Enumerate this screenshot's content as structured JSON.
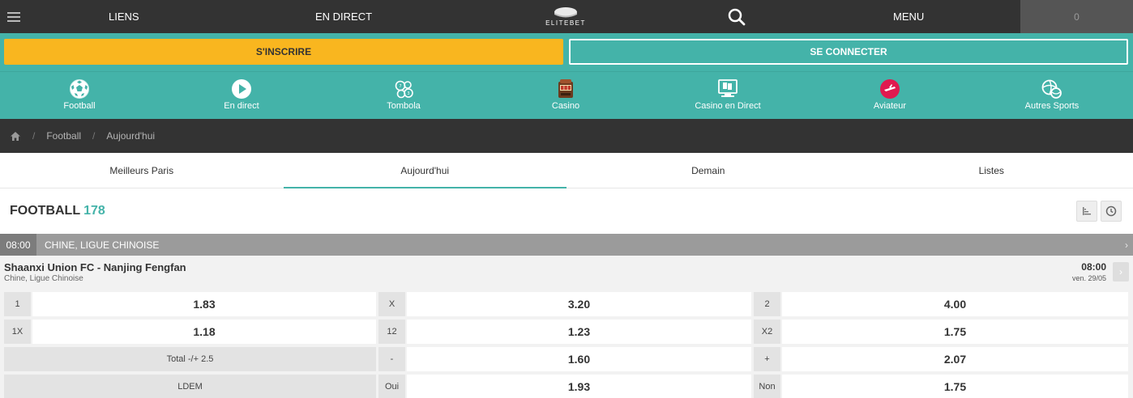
{
  "topbar": {
    "menu_icon": "hamburger-icon",
    "links": "LIENS",
    "live": "EN DIRECT",
    "logo_text": "ELITEBET",
    "search_icon": "search-icon",
    "menu": "MENU",
    "balance": "0"
  },
  "auth": {
    "register": "S'INSCRIRE",
    "login": "SE CONNECTER"
  },
  "categories": [
    {
      "label": "Football",
      "icon": "football-icon"
    },
    {
      "label": "En direct",
      "icon": "play-icon"
    },
    {
      "label": "Tombola",
      "icon": "lottery-balls-icon"
    },
    {
      "label": "Casino",
      "icon": "slot-machine-icon"
    },
    {
      "label": "Casino en Direct",
      "icon": "live-casino-icon"
    },
    {
      "label": "Aviateur",
      "icon": "airplane-icon"
    },
    {
      "label": "Autres Sports",
      "icon": "sports-balls-icon"
    }
  ],
  "breadcrumb": {
    "home_icon": "home-icon",
    "sep": "/",
    "item1": "Football",
    "item2": "Aujourd'hui"
  },
  "tabs": [
    {
      "label": "Meilleurs Paris"
    },
    {
      "label": "Aujourd'hui",
      "active": true
    },
    {
      "label": "Demain"
    },
    {
      "label": "Listes"
    }
  ],
  "section": {
    "title": "FOOTBALL",
    "count": "178",
    "sort_icon": "sort-bars-icon",
    "clock_icon": "clock-icon"
  },
  "league": {
    "time": "08:00",
    "name": "CHINE, LIGUE CHINOISE",
    "chevron": "›"
  },
  "match": {
    "teams": "Shaanxi Union FC - Nanjing Fengfan",
    "competition": "Chine, Ligue Chinoise",
    "time": "08:00",
    "date": "ven. 29/05",
    "chevron": "›"
  },
  "odds": [
    [
      {
        "label": "1",
        "value": "1.83"
      },
      {
        "label": "X",
        "value": "3.20"
      },
      {
        "label": "2",
        "value": "4.00"
      }
    ],
    [
      {
        "label": "1X",
        "value": "1.18"
      },
      {
        "label": "12",
        "value": "1.23"
      },
      {
        "label": "X2",
        "value": "1.75"
      }
    ],
    [
      {
        "label": "Total -/+ 2.5",
        "value": ""
      },
      {
        "label": "-",
        "value": "1.60"
      },
      {
        "label": "+",
        "value": "2.07"
      }
    ],
    [
      {
        "label": "LDEM",
        "value": ""
      },
      {
        "label": "Oui",
        "value": "1.93"
      },
      {
        "label": "Non",
        "value": "1.75"
      }
    ]
  ],
  "colors": {
    "teal": "#44b3a9",
    "yellow": "#f9b61f",
    "dark": "#333333"
  }
}
